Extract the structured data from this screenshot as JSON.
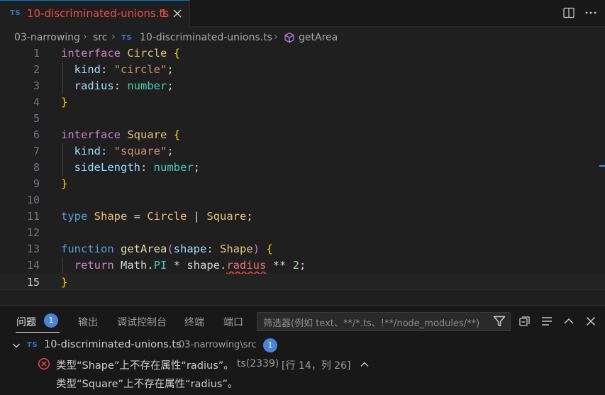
{
  "tab": {
    "badge": "TS",
    "title": "10-discriminated-unions.ts",
    "problem_count": "1"
  },
  "breadcrumb": {
    "folder": "03-narrowing",
    "src": "src",
    "badge": "TS",
    "file": "10-discriminated-unions.ts",
    "symbol": "getArea"
  },
  "editor": {
    "line_numbers": [
      "1",
      "2",
      "3",
      "4",
      "5",
      "6",
      "7",
      "8",
      "9",
      "10",
      "11",
      "12",
      "13",
      "14",
      "15"
    ],
    "active_line": "15",
    "lines": [
      [
        {
          "t": "interface",
          "c": "kw"
        },
        {
          "t": " ",
          "c": "pl"
        },
        {
          "t": "Circle",
          "c": "ty"
        },
        {
          "t": " ",
          "c": "pl"
        },
        {
          "t": "{",
          "c": "brace"
        }
      ],
      [
        {
          "t": "  kind",
          "c": "prop"
        },
        {
          "t": ": ",
          "c": "pl"
        },
        {
          "t": "\"circle\"",
          "c": "str"
        },
        {
          "t": ";",
          "c": "pl"
        }
      ],
      [
        {
          "t": "  radius",
          "c": "prop"
        },
        {
          "t": ": ",
          "c": "pl"
        },
        {
          "t": "number",
          "c": "prim"
        },
        {
          "t": ";",
          "c": "pl"
        }
      ],
      [
        {
          "t": "}",
          "c": "brace"
        }
      ],
      [],
      [
        {
          "t": "interface",
          "c": "kw"
        },
        {
          "t": " ",
          "c": "pl"
        },
        {
          "t": "Square",
          "c": "ty"
        },
        {
          "t": " ",
          "c": "pl"
        },
        {
          "t": "{",
          "c": "brace"
        }
      ],
      [
        {
          "t": "  kind",
          "c": "prop"
        },
        {
          "t": ": ",
          "c": "pl"
        },
        {
          "t": "\"square\"",
          "c": "str"
        },
        {
          "t": ";",
          "c": "pl"
        }
      ],
      [
        {
          "t": "  sideLength",
          "c": "prop"
        },
        {
          "t": ": ",
          "c": "pl"
        },
        {
          "t": "number",
          "c": "prim"
        },
        {
          "t": ";",
          "c": "pl"
        }
      ],
      [
        {
          "t": "}",
          "c": "brace"
        }
      ],
      [],
      [
        {
          "t": "type",
          "c": "kwb"
        },
        {
          "t": " ",
          "c": "pl"
        },
        {
          "t": "Shape",
          "c": "ty"
        },
        {
          "t": " = ",
          "c": "op"
        },
        {
          "t": "Circle",
          "c": "ty"
        },
        {
          "t": " | ",
          "c": "op"
        },
        {
          "t": "Square",
          "c": "ty"
        },
        {
          "t": ";",
          "c": "pl"
        }
      ],
      [],
      [
        {
          "t": "function",
          "c": "kwb"
        },
        {
          "t": " ",
          "c": "pl"
        },
        {
          "t": "getArea",
          "c": "fn"
        },
        {
          "t": "(",
          "c": "paren"
        },
        {
          "t": "shape",
          "c": "prop"
        },
        {
          "t": ": ",
          "c": "pl"
        },
        {
          "t": "Shape",
          "c": "ty"
        },
        {
          "t": ")",
          "c": "paren"
        },
        {
          "t": " ",
          "c": "pl"
        },
        {
          "t": "{",
          "c": "brace"
        }
      ],
      [
        {
          "t": "  return",
          "c": "kw"
        },
        {
          "t": " Math.",
          "c": "pl"
        },
        {
          "t": "PI",
          "c": "prim"
        },
        {
          "t": " * ",
          "c": "op"
        },
        {
          "t": "shape.",
          "c": "pl"
        },
        {
          "t": "radius",
          "c": "err"
        },
        {
          "t": " ** ",
          "c": "op"
        },
        {
          "t": "2",
          "c": "num"
        },
        {
          "t": ";",
          "c": "pl"
        }
      ],
      [
        {
          "t": "}",
          "c": "brace"
        }
      ]
    ]
  },
  "panel": {
    "tabs": [
      "问题",
      "输出",
      "调试控制台",
      "终端",
      "端口"
    ],
    "problems_badge": "1",
    "filter_placeholder": "筛选器(例如 text、**/*.ts、!**/node_modules/**)",
    "file_badge": "TS",
    "file_name": "10-discriminated-unions.ts",
    "file_path": "03-narrowing\\src",
    "file_count": "1",
    "error_message": "类型“Shape”上不存在属性“radius”。",
    "error_code": "ts(2339)",
    "error_location": "[行 14，列 26]",
    "error_detail": "类型“Square”上不存在属性“radius”。"
  },
  "colors": {
    "accent": "#0078d4",
    "error": "#f14c4c",
    "badge": "#4d83d6"
  }
}
